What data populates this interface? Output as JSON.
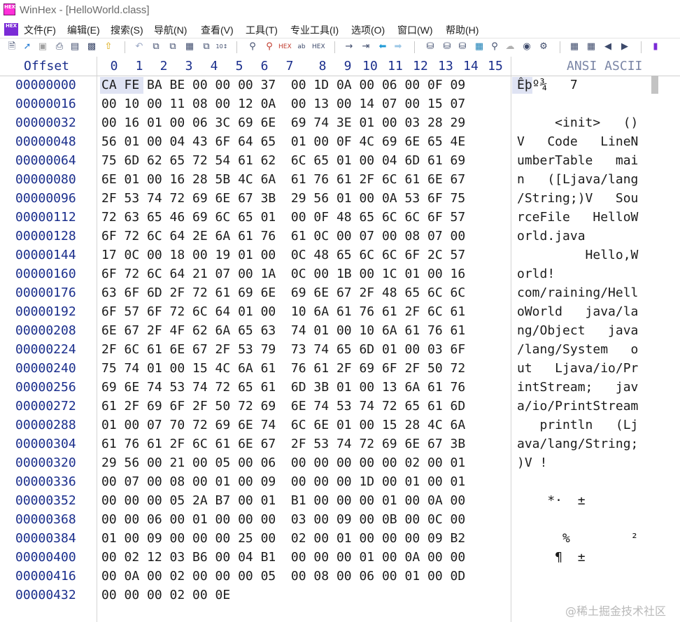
{
  "window": {
    "title": "WinHex - [HelloWorld.class]",
    "app_icon": "HEX"
  },
  "menu": [
    "文件(F)",
    "编辑(E)",
    "搜索(S)",
    "导航(N)",
    "查看(V)",
    "工具(T)",
    "专业工具(I)",
    "选项(O)",
    "窗口(W)",
    "帮助(H)"
  ],
  "toolbar_icons": [
    "new-file-icon",
    "open-icon",
    "save-icon",
    "print-icon",
    "properties-icon",
    "export-icon",
    "undo-icon",
    "copy-icon",
    "paste-icon",
    "paste-special-icon",
    "write-icon",
    "hex-convert-icon",
    "find-icon",
    "find-next-icon",
    "find-hex-icon",
    "replace-icon",
    "replace-hex-icon",
    "goto-offset-icon",
    "goto-sector-icon",
    "back-icon",
    "forward-icon",
    "disk-icon",
    "open-disk-icon",
    "ram-icon",
    "calculator-icon",
    "zoom-icon",
    "snapshot-icon",
    "settings-icon",
    "compare-icon",
    "table-icon",
    "prev-icon",
    "next-icon",
    "help-icon"
  ],
  "header": {
    "offset_label": "Offset",
    "columns": [
      "0",
      "1",
      "2",
      "3",
      "4",
      "5",
      "6",
      "7",
      "8",
      "9",
      "10",
      "11",
      "12",
      "13",
      "14",
      "15"
    ],
    "ansi_label": "ANSI ASCII"
  },
  "rows": [
    {
      "offset": "00000000",
      "hex": "CA FE BA BE 00 00 00 37  00 1D 0A 00 06 00 0F 09",
      "ascii": "Êþº¾   7"
    },
    {
      "offset": "00000016",
      "hex": "00 10 00 11 08 00 12 0A  00 13 00 14 07 00 15 07",
      "ascii": ""
    },
    {
      "offset": "00000032",
      "hex": "00 16 01 00 06 3C 69 6E  69 74 3E 01 00 03 28 29",
      "ascii": "     <init>   ()"
    },
    {
      "offset": "00000048",
      "hex": "56 01 00 04 43 6F 64 65  01 00 0F 4C 69 6E 65 4E",
      "ascii": "V   Code   LineN"
    },
    {
      "offset": "00000064",
      "hex": "75 6D 62 65 72 54 61 62  6C 65 01 00 04 6D 61 69",
      "ascii": "umberTable   mai"
    },
    {
      "offset": "00000080",
      "hex": "6E 01 00 16 28 5B 4C 6A  61 76 61 2F 6C 61 6E 67",
      "ascii": "n   ([Ljava/lang"
    },
    {
      "offset": "00000096",
      "hex": "2F 53 74 72 69 6E 67 3B  29 56 01 00 0A 53 6F 75",
      "ascii": "/String;)V   Sou"
    },
    {
      "offset": "00000112",
      "hex": "72 63 65 46 69 6C 65 01  00 0F 48 65 6C 6C 6F 57",
      "ascii": "rceFile   HelloW"
    },
    {
      "offset": "00000128",
      "hex": "6F 72 6C 64 2E 6A 61 76  61 0C 00 07 00 08 07 00",
      "ascii": "orld.java"
    },
    {
      "offset": "00000144",
      "hex": "17 0C 00 18 00 19 01 00  0C 48 65 6C 6C 6F 2C 57",
      "ascii": "         Hello,W"
    },
    {
      "offset": "00000160",
      "hex": "6F 72 6C 64 21 07 00 1A  0C 00 1B 00 1C 01 00 16",
      "ascii": "orld!"
    },
    {
      "offset": "00000176",
      "hex": "63 6F 6D 2F 72 61 69 6E  69 6E 67 2F 48 65 6C 6C",
      "ascii": "com/raining/Hell"
    },
    {
      "offset": "00000192",
      "hex": "6F 57 6F 72 6C 64 01 00  10 6A 61 76 61 2F 6C 61",
      "ascii": "oWorld   java/la"
    },
    {
      "offset": "00000208",
      "hex": "6E 67 2F 4F 62 6A 65 63  74 01 00 10 6A 61 76 61",
      "ascii": "ng/Object   java"
    },
    {
      "offset": "00000224",
      "hex": "2F 6C 61 6E 67 2F 53 79  73 74 65 6D 01 00 03 6F",
      "ascii": "/lang/System   o"
    },
    {
      "offset": "00000240",
      "hex": "75 74 01 00 15 4C 6A 61  76 61 2F 69 6F 2F 50 72",
      "ascii": "ut   Ljava/io/Pr"
    },
    {
      "offset": "00000256",
      "hex": "69 6E 74 53 74 72 65 61  6D 3B 01 00 13 6A 61 76",
      "ascii": "intStream;   jav"
    },
    {
      "offset": "00000272",
      "hex": "61 2F 69 6F 2F 50 72 69  6E 74 53 74 72 65 61 6D",
      "ascii": "a/io/PrintStream"
    },
    {
      "offset": "00000288",
      "hex": "01 00 07 70 72 69 6E 74  6C 6E 01 00 15 28 4C 6A",
      "ascii": "   println   (Lj"
    },
    {
      "offset": "00000304",
      "hex": "61 76 61 2F 6C 61 6E 67  2F 53 74 72 69 6E 67 3B",
      "ascii": "ava/lang/String;"
    },
    {
      "offset": "00000320",
      "hex": "29 56 00 21 00 05 00 06  00 00 00 00 00 02 00 01",
      "ascii": ")V !"
    },
    {
      "offset": "00000336",
      "hex": "00 07 00 08 00 01 00 09  00 00 00 1D 00 01 00 01",
      "ascii": ""
    },
    {
      "offset": "00000352",
      "hex": "00 00 00 05 2A B7 00 01  B1 00 00 00 01 00 0A 00",
      "ascii": "    *·  ±"
    },
    {
      "offset": "00000368",
      "hex": "00 00 06 00 01 00 00 00  03 00 09 00 0B 00 0C 00",
      "ascii": ""
    },
    {
      "offset": "00000384",
      "hex": "01 00 09 00 00 00 25 00  02 00 01 00 00 00 09 B2",
      "ascii": "      %        ²"
    },
    {
      "offset": "00000400",
      "hex": "00 02 12 03 B6 00 04 B1  00 00 00 01 00 0A 00 00",
      "ascii": "     ¶  ±"
    },
    {
      "offset": "00000416",
      "hex": "00 0A 00 02 00 00 00 05  00 08 00 06 00 01 00 0D",
      "ascii": ""
    },
    {
      "offset": "00000432",
      "hex": "00 00 00 02 00 0E",
      "ascii": ""
    }
  ],
  "watermark": "@稀土掘金技术社区"
}
